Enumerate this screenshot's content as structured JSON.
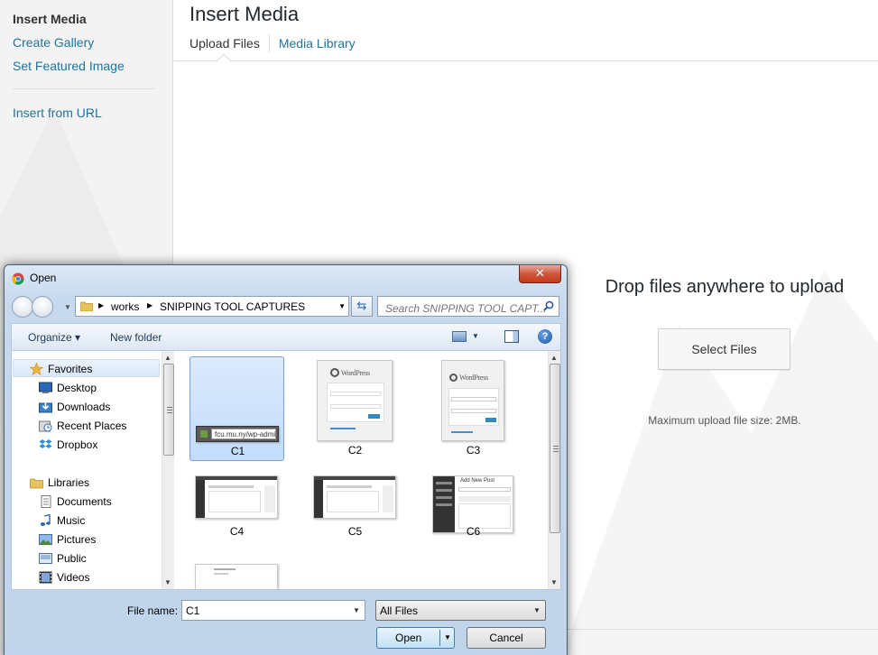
{
  "sidebar": {
    "items": [
      {
        "label": "Insert Media",
        "active": true
      },
      {
        "label": "Create Gallery"
      },
      {
        "label": "Set Featured Image"
      },
      {
        "label": "Insert from URL"
      }
    ]
  },
  "main": {
    "title": "Insert Media",
    "tabs": [
      {
        "label": "Upload Files",
        "active": true
      },
      {
        "label": "Media Library"
      }
    ],
    "drop_text": "Drop files anywhere to upload",
    "select_button": "Select Files",
    "max_size": "Maximum upload file size: 2MB."
  },
  "dialog": {
    "title": "Open",
    "close_glyph": "✕",
    "breadcrumb": [
      "works",
      "SNIPPING TOOL CAPTURES"
    ],
    "search_placeholder": "Search SNIPPING TOOL CAPT...",
    "toolbar": {
      "organize": "Organize ▾",
      "new_folder": "New folder",
      "help": "?"
    },
    "nav": {
      "favorites": {
        "label": "Favorites",
        "items": [
          "Desktop",
          "Downloads",
          "Recent Places",
          "Dropbox"
        ]
      },
      "libraries": {
        "label": "Libraries",
        "items": [
          "Documents",
          "Music",
          "Pictures",
          "Public",
          "Videos"
        ]
      }
    },
    "files": [
      {
        "label": "C1",
        "selected": true,
        "url_snippet": "fcu.mu.ny/wp-admin/"
      },
      {
        "label": "C2",
        "logo": "WordPress"
      },
      {
        "label": "C3",
        "logo": "WordPress"
      },
      {
        "label": "C4"
      },
      {
        "label": "C5"
      },
      {
        "label": "C6",
        "heading": "Add New Post"
      },
      {
        "label": ""
      }
    ],
    "filename_label": "File name:",
    "filename_value": "C1",
    "filetype_value": "All Files",
    "open_button": "Open",
    "cancel_button": "Cancel"
  },
  "colors": {
    "link": "#21759b",
    "sidebar_bg": "#f3f3f3",
    "dialog_frame": "#c2d6ea"
  }
}
